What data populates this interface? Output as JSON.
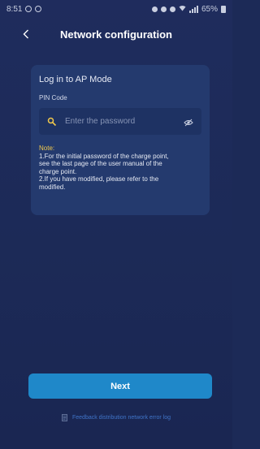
{
  "status_bar": {
    "time": "8:51",
    "battery": "65%"
  },
  "header": {
    "title": "Network configuration",
    "back_icon": "chevron-left-icon"
  },
  "card": {
    "title": "Log in to AP Mode",
    "pin_label": "PIN Code",
    "password": {
      "value": "",
      "placeholder": "Enter the password",
      "leading_icon": "key-icon",
      "trailing_icon": "eye-icon"
    },
    "note": {
      "label": "Note:",
      "lines": [
        "1.For the initial password of the charge point,",
        "see the last page of the user manual of the",
        "charge point.",
        "2.If you have modified, please refer to the",
        "modified."
      ]
    }
  },
  "actions": {
    "next_label": "Next",
    "feedback_label": "Feedback distribution network error log",
    "feedback_icon": "document-icon"
  },
  "colors": {
    "background": "#1c2a57",
    "card": "#243a6e",
    "input": "#1e3263",
    "accent_button": "#1f88c9",
    "note_label": "#f2c94c",
    "link": "#3f74c8"
  }
}
